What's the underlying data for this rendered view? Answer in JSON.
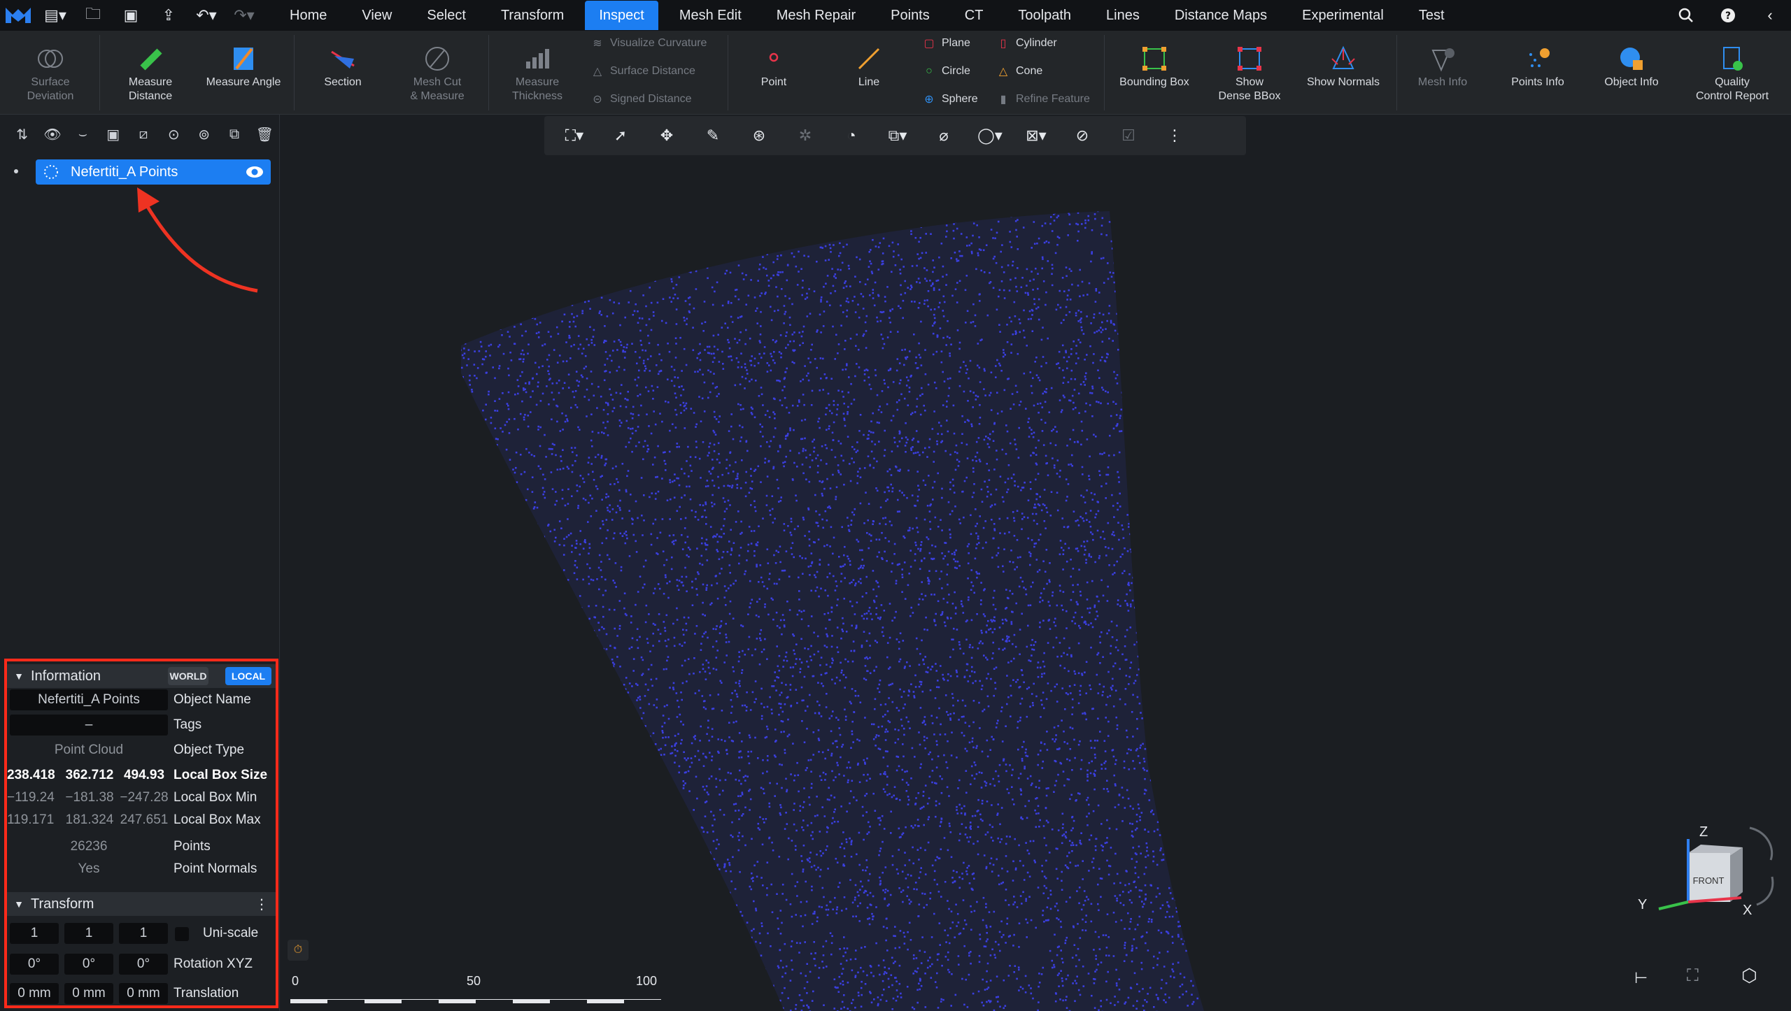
{
  "menu": {
    "tabs": [
      "Home",
      "View",
      "Select",
      "Transform",
      "Inspect",
      "Mesh Edit",
      "Mesh Repair",
      "Points",
      "CT",
      "Toolpath",
      "Lines",
      "Distance Maps",
      "Experimental",
      "Test"
    ],
    "active_tab": "Inspect"
  },
  "ribbon": {
    "surface_deviation": "Surface\nDeviation",
    "measure_distance": "Measure\nDistance",
    "measure_angle": "Measure Angle",
    "section": "Section",
    "mesh_cut": "Mesh Cut\n& Measure",
    "measure_thickness": "Measure\nThickness",
    "visualize_curvature": "Visualize Curvature",
    "surface_distance": "Surface Distance",
    "signed_distance": "Signed Distance",
    "point": "Point",
    "line": "Line",
    "plane": "Plane",
    "circle": "Circle",
    "sphere": "Sphere",
    "cylinder": "Cylinder",
    "cone": "Cone",
    "refine_feature": "Refine Feature",
    "bounding_box": "Bounding Box",
    "show_dense_bbox": "Show\nDense BBox",
    "show_normals": "Show Normals",
    "mesh_info": "Mesh Info",
    "points_info": "Points Info",
    "object_info": "Object Info",
    "quality_report": "Quality\nControl Report"
  },
  "tree": {
    "item_label": "Nefertiti_A Points"
  },
  "info": {
    "title": "Information",
    "world": "WORLD",
    "local": "LOCAL",
    "object_name_value": "Nefertiti_A Points",
    "object_name_label": "Object Name",
    "tags_value": "–",
    "tags_label": "Tags",
    "object_type_value": "Point Cloud",
    "object_type_label": "Object Type",
    "box_size": [
      "238.418",
      "362.712",
      "494.93"
    ],
    "box_size_label": "Local Box Size",
    "box_min": [
      "−119.24",
      "−181.38",
      "−247.28"
    ],
    "box_min_label": "Local Box Min",
    "box_max": [
      "119.171",
      "181.324",
      "247.651"
    ],
    "box_max_label": "Local Box Max",
    "points_value": "26236",
    "points_label": "Points",
    "normals_value": "Yes",
    "normals_label": "Point Normals"
  },
  "transform": {
    "title": "Transform",
    "scale": [
      "1",
      "1",
      "1"
    ],
    "uniscale_label": "Uni-scale",
    "rotation": [
      "0°",
      "0°",
      "0°"
    ],
    "rotation_label": "Rotation XYZ",
    "translation": [
      "0 mm",
      "0 mm",
      "0 mm"
    ],
    "translation_label": "Translation"
  },
  "viewport": {
    "scale_ticks": [
      "0",
      "50",
      "100"
    ],
    "cube_face": "FRONT",
    "axis_z": "Z",
    "axis_y": "Y",
    "axis_x": "X"
  },
  "colors": {
    "accent": "#1c7ef2",
    "highlight": "#ff2a1a",
    "points": "#3b3fe0"
  }
}
